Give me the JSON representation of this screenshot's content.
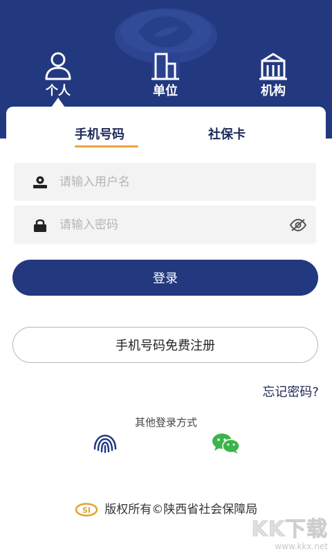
{
  "user_types": {
    "personal": "个人",
    "unit": "单位",
    "org": "机构"
  },
  "login_tabs": {
    "phone": "手机号码",
    "sscard": "社保卡"
  },
  "form": {
    "username_placeholder": "请输入用户名",
    "password_placeholder": "请输入密码"
  },
  "actions": {
    "login": "登录",
    "register": "手机号码免费注册",
    "forgot": "忘记密码?"
  },
  "other_login": {
    "title": "其他登录方式",
    "methods": [
      "fingerprint-icon",
      "wechat-icon"
    ]
  },
  "footer": {
    "text": "版权所有©陕西省社会保障局",
    "logo_text": "SI"
  },
  "watermark": {
    "main": "KK下载",
    "url": "www.kkx.net"
  },
  "colors": {
    "primary": "#23397f",
    "accent_underline": "#e8a33c",
    "wechat": "#3bb54a"
  }
}
